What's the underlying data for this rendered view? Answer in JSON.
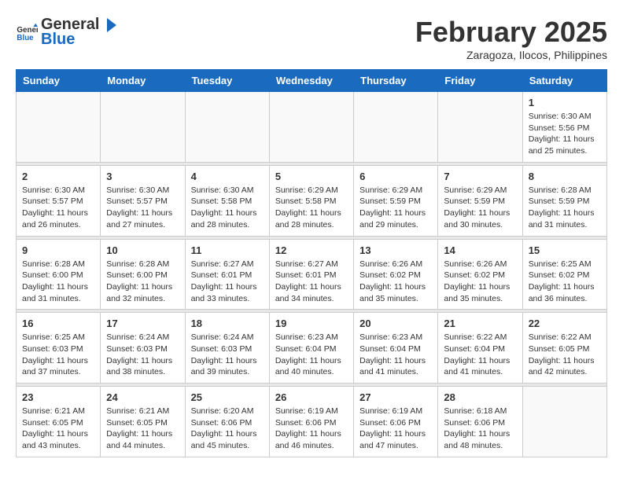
{
  "header": {
    "logo_general": "General",
    "logo_blue": "Blue",
    "month_title": "February 2025",
    "subtitle": "Zaragoza, Ilocos, Philippines"
  },
  "weekdays": [
    "Sunday",
    "Monday",
    "Tuesday",
    "Wednesday",
    "Thursday",
    "Friday",
    "Saturday"
  ],
  "weeks": [
    [
      {
        "day": "",
        "info": ""
      },
      {
        "day": "",
        "info": ""
      },
      {
        "day": "",
        "info": ""
      },
      {
        "day": "",
        "info": ""
      },
      {
        "day": "",
        "info": ""
      },
      {
        "day": "",
        "info": ""
      },
      {
        "day": "1",
        "info": "Sunrise: 6:30 AM\nSunset: 5:56 PM\nDaylight: 11 hours and 25 minutes."
      }
    ],
    [
      {
        "day": "2",
        "info": "Sunrise: 6:30 AM\nSunset: 5:57 PM\nDaylight: 11 hours and 26 minutes."
      },
      {
        "day": "3",
        "info": "Sunrise: 6:30 AM\nSunset: 5:57 PM\nDaylight: 11 hours and 27 minutes."
      },
      {
        "day": "4",
        "info": "Sunrise: 6:30 AM\nSunset: 5:58 PM\nDaylight: 11 hours and 28 minutes."
      },
      {
        "day": "5",
        "info": "Sunrise: 6:29 AM\nSunset: 5:58 PM\nDaylight: 11 hours and 28 minutes."
      },
      {
        "day": "6",
        "info": "Sunrise: 6:29 AM\nSunset: 5:59 PM\nDaylight: 11 hours and 29 minutes."
      },
      {
        "day": "7",
        "info": "Sunrise: 6:29 AM\nSunset: 5:59 PM\nDaylight: 11 hours and 30 minutes."
      },
      {
        "day": "8",
        "info": "Sunrise: 6:28 AM\nSunset: 5:59 PM\nDaylight: 11 hours and 31 minutes."
      }
    ],
    [
      {
        "day": "9",
        "info": "Sunrise: 6:28 AM\nSunset: 6:00 PM\nDaylight: 11 hours and 31 minutes."
      },
      {
        "day": "10",
        "info": "Sunrise: 6:28 AM\nSunset: 6:00 PM\nDaylight: 11 hours and 32 minutes."
      },
      {
        "day": "11",
        "info": "Sunrise: 6:27 AM\nSunset: 6:01 PM\nDaylight: 11 hours and 33 minutes."
      },
      {
        "day": "12",
        "info": "Sunrise: 6:27 AM\nSunset: 6:01 PM\nDaylight: 11 hours and 34 minutes."
      },
      {
        "day": "13",
        "info": "Sunrise: 6:26 AM\nSunset: 6:02 PM\nDaylight: 11 hours and 35 minutes."
      },
      {
        "day": "14",
        "info": "Sunrise: 6:26 AM\nSunset: 6:02 PM\nDaylight: 11 hours and 35 minutes."
      },
      {
        "day": "15",
        "info": "Sunrise: 6:25 AM\nSunset: 6:02 PM\nDaylight: 11 hours and 36 minutes."
      }
    ],
    [
      {
        "day": "16",
        "info": "Sunrise: 6:25 AM\nSunset: 6:03 PM\nDaylight: 11 hours and 37 minutes."
      },
      {
        "day": "17",
        "info": "Sunrise: 6:24 AM\nSunset: 6:03 PM\nDaylight: 11 hours and 38 minutes."
      },
      {
        "day": "18",
        "info": "Sunrise: 6:24 AM\nSunset: 6:03 PM\nDaylight: 11 hours and 39 minutes."
      },
      {
        "day": "19",
        "info": "Sunrise: 6:23 AM\nSunset: 6:04 PM\nDaylight: 11 hours and 40 minutes."
      },
      {
        "day": "20",
        "info": "Sunrise: 6:23 AM\nSunset: 6:04 PM\nDaylight: 11 hours and 41 minutes."
      },
      {
        "day": "21",
        "info": "Sunrise: 6:22 AM\nSunset: 6:04 PM\nDaylight: 11 hours and 41 minutes."
      },
      {
        "day": "22",
        "info": "Sunrise: 6:22 AM\nSunset: 6:05 PM\nDaylight: 11 hours and 42 minutes."
      }
    ],
    [
      {
        "day": "23",
        "info": "Sunrise: 6:21 AM\nSunset: 6:05 PM\nDaylight: 11 hours and 43 minutes."
      },
      {
        "day": "24",
        "info": "Sunrise: 6:21 AM\nSunset: 6:05 PM\nDaylight: 11 hours and 44 minutes."
      },
      {
        "day": "25",
        "info": "Sunrise: 6:20 AM\nSunset: 6:06 PM\nDaylight: 11 hours and 45 minutes."
      },
      {
        "day": "26",
        "info": "Sunrise: 6:19 AM\nSunset: 6:06 PM\nDaylight: 11 hours and 46 minutes."
      },
      {
        "day": "27",
        "info": "Sunrise: 6:19 AM\nSunset: 6:06 PM\nDaylight: 11 hours and 47 minutes."
      },
      {
        "day": "28",
        "info": "Sunrise: 6:18 AM\nSunset: 6:06 PM\nDaylight: 11 hours and 48 minutes."
      },
      {
        "day": "",
        "info": ""
      }
    ]
  ]
}
